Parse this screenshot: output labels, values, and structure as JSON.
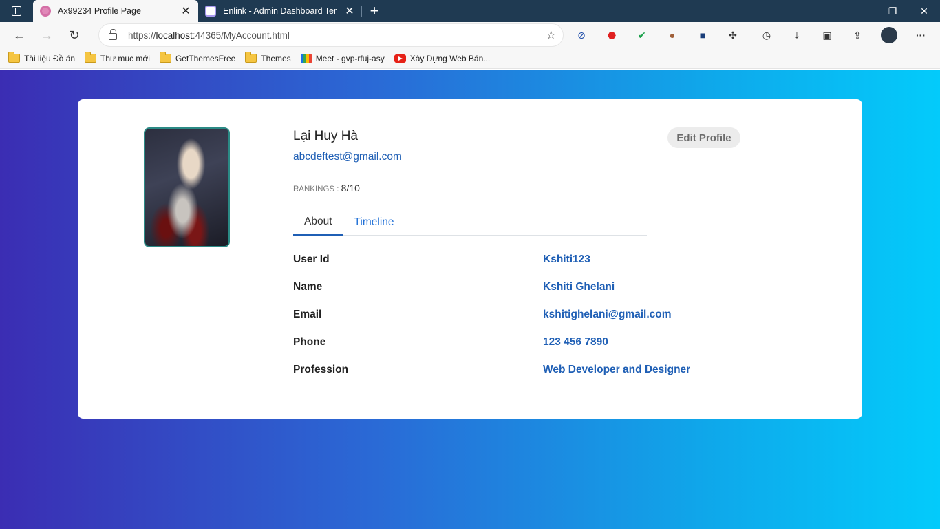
{
  "browser": {
    "tabs": [
      {
        "title": "Ax99234 Profile Page",
        "active": true
      },
      {
        "title": "Enlink - Admin Dashboard Templ",
        "active": false
      }
    ],
    "url": {
      "prefix": "https://",
      "host": "localhost",
      "rest": ":44365/MyAccount.html"
    },
    "bookmarks": [
      {
        "label": "Tài liệu Đồ án",
        "icon": "folder-icon"
      },
      {
        "label": "Thư mục mới",
        "icon": "folder-icon"
      },
      {
        "label": "GetThemesFree",
        "icon": "folder-icon"
      },
      {
        "label": "Themes",
        "icon": "folder-icon"
      },
      {
        "label": "Meet - gvp-rfuj-asy",
        "icon": "meet-icon"
      },
      {
        "label": "Xây Dựng Web Bán...",
        "icon": "youtube-icon"
      }
    ]
  },
  "profile": {
    "name": "Lại Huy Hà",
    "email": "abcdeftest@gmail.com",
    "rankings_label": "RANKINGS : ",
    "rankings_value": "8/10",
    "edit_button": "Edit Profile",
    "tabs": [
      "About",
      "Timeline"
    ],
    "details": [
      {
        "label": "User Id",
        "value": "Kshiti123"
      },
      {
        "label": "Name",
        "value": "Kshiti Ghelani"
      },
      {
        "label": "Email",
        "value": "kshitighelani@gmail.com"
      },
      {
        "label": "Phone",
        "value": "123 456 7890"
      },
      {
        "label": "Profession",
        "value": "Web Developer and Designer"
      }
    ]
  },
  "colors": {
    "accent": "#1f5fb5",
    "gradient_start": "#3b2db3",
    "gradient_end": "#03cbfb",
    "titlebar": "#1f3a52"
  }
}
